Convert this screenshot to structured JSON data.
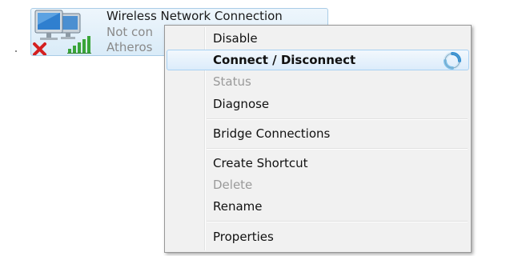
{
  "connection": {
    "name": "Wireless Network Connection",
    "status_text": "Not con",
    "adapter_text": "Atheros",
    "icon": "wireless-network-icon",
    "state_icon": "disconnected-x-icon",
    "signal_icon": "signal-strength-icon"
  },
  "context_menu": {
    "items": [
      {
        "label": "Disable",
        "enabled": true
      },
      {
        "label": "Connect / Disconnect",
        "enabled": true,
        "default": true,
        "highlighted": true
      },
      {
        "label": "Status",
        "enabled": false
      },
      {
        "label": "Diagnose",
        "enabled": true
      },
      {
        "label": "Bridge Connections",
        "enabled": true
      },
      {
        "label": "Create Shortcut",
        "enabled": true
      },
      {
        "label": "Delete",
        "enabled": false
      },
      {
        "label": "Rename",
        "enabled": true
      },
      {
        "label": "Properties",
        "enabled": true
      }
    ],
    "busy_icon": "busy-spinner-icon"
  },
  "colors": {
    "highlight": "#dcecfb",
    "highlight_border": "#a8d1f3",
    "disabled_text": "#9a9a9a",
    "signal_green": "#3aa53a",
    "error_red": "#d42020"
  }
}
